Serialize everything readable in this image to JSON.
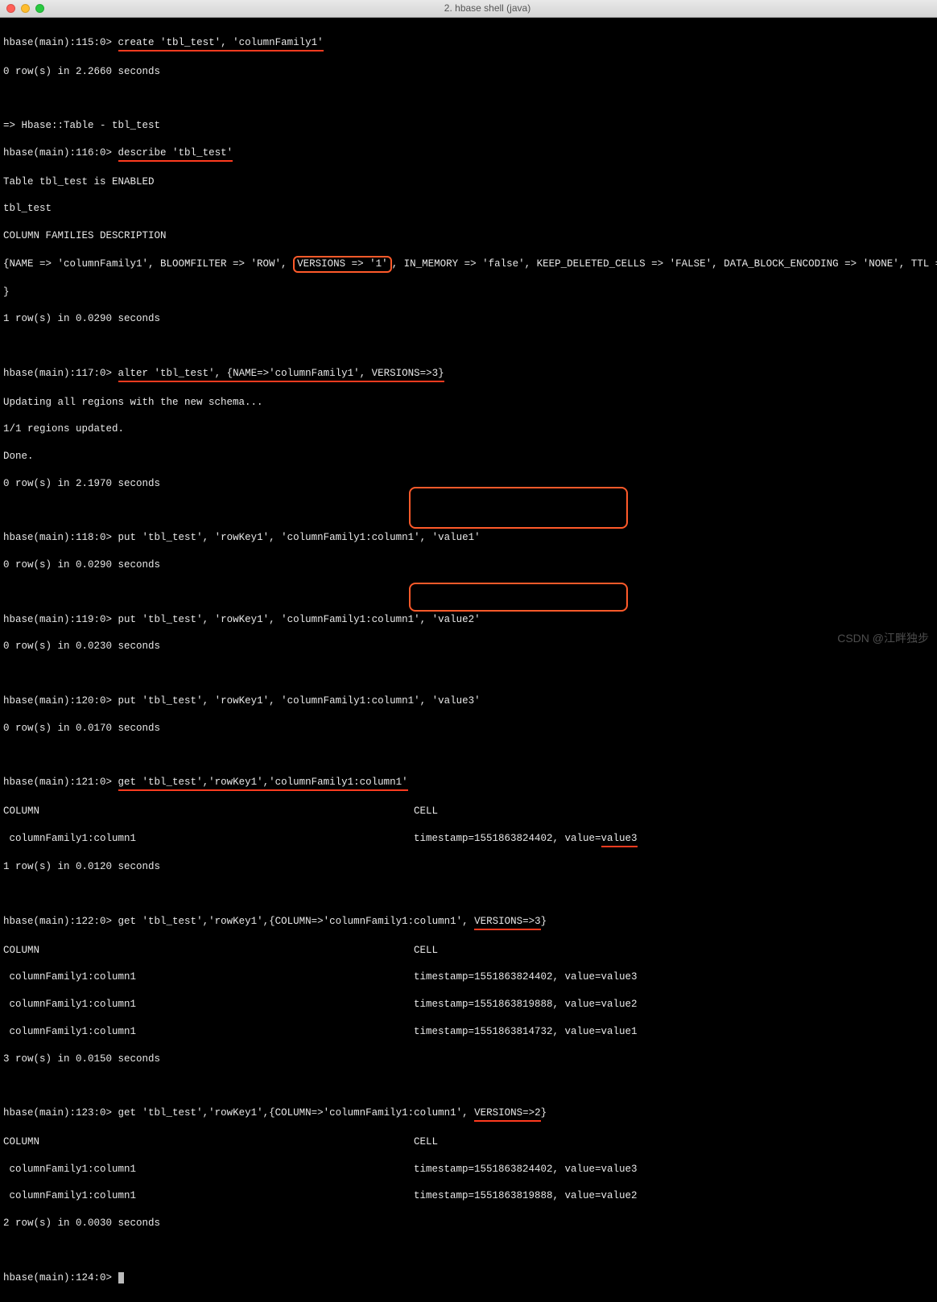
{
  "window": {
    "title": "2. hbase shell (java)"
  },
  "prompts": {
    "p115": "hbase(main):115:0>",
    "p116": "hbase(main):116:0>",
    "p117": "hbase(main):117:0>",
    "p118": "hbase(main):118:0>",
    "p119": "hbase(main):119:0>",
    "p120": "hbase(main):120:0>",
    "p121": "hbase(main):121:0>",
    "p122": "hbase(main):122:0>",
    "p123": "hbase(main):123:0>",
    "p124": "hbase(main):124:0>"
  },
  "cmd": {
    "create": "create 'tbl_test', 'columnFamily1'",
    "describe": "describe 'tbl_test'",
    "alter": "alter 'tbl_test', {NAME=>'columnFamily1', VERSIONS=>3}",
    "put1": "put 'tbl_test', 'rowKey1', 'columnFamily1:column1', 'value1'",
    "put2": "put 'tbl_test', 'rowKey1', 'columnFamily1:column1', 'value2'",
    "put3": "put 'tbl_test', 'rowKey1', 'columnFamily1:column1', 'value3'",
    "get1": "get 'tbl_test','rowKey1','columnFamily1:column1'",
    "get2_a": "get 'tbl_test','rowKey1',{COLUMN=>'columnFamily1:column1', ",
    "get2_b": "VERSIONS=>3",
    "get2_c": "}",
    "get3_a": "get 'tbl_test','rowKey1',{COLUMN=>'columnFamily1:column1', ",
    "get3_b": "VERSIONS=>2",
    "get3_c": "}"
  },
  "out": {
    "create_rows": "0 row(s) in 2.2660 seconds",
    "hbase_table": "=> Hbase::Table - tbl_test",
    "enabled": "Table tbl_test is ENABLED",
    "tbl": "tbl_test",
    "cfdesc": "COLUMN FAMILIES DESCRIPTION",
    "desc_a": "{NAME => 'columnFamily1', BLOOMFILTER => 'ROW', ",
    "desc_ver": "VERSIONS => '1'",
    "desc_b": ", IN_MEMORY => 'false', KEEP_DELETED_CELLS => 'FALSE', DATA_BLOCK_ENCODING => 'NONE', TTL => 'FOREVER',",
    "brace": "}",
    "row_0290": "1 row(s) in 0.0290 seconds",
    "alter_updating": "Updating all regions with the new schema...",
    "alter_regions": "1/1 regions updated.",
    "alter_done": "Done.",
    "alter_rows": "0 row(s) in 2.1970 seconds",
    "put1_rows": "0 row(s) in 0.0290 seconds",
    "put2_rows": "0 row(s) in 0.0230 seconds",
    "put3_rows": "0 row(s) in 0.0170 seconds",
    "hdr_column": "COLUMN",
    "hdr_cell": "CELL",
    "cf_col": " columnFamily1:column1",
    "cell_v3": "timestamp=1551863824402, value=",
    "cell_v3b": "value3",
    "row_0120": "1 row(s) in 0.0120 seconds",
    "v3_r1": "timestamp=1551863824402, value=value3",
    "v3_r2": "timestamp=1551863819888, value=value2",
    "v3_r3": "timestamp=1551863814732, value=value1",
    "row_0150": "3 row(s) in 0.0150 seconds",
    "v2_r1": "timestamp=1551863824402, value=value3",
    "v2_r2": "timestamp=1551863819888, value=value2",
    "row_0030": "2 row(s) in 0.0030 seconds"
  },
  "watermark": "CSDN @江畔独步"
}
